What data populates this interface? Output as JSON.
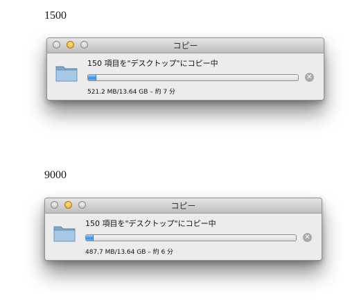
{
  "headings": [
    "1500",
    "9000"
  ],
  "windows": [
    {
      "title": "コピー",
      "message": "150 項目を\"デスクトップ\"にコピー中",
      "status": "521.2 MB/13.64 GB – 約 7 分",
      "progress_fraction": 0.038
    },
    {
      "title": "コピー",
      "message": "150 項目を\"デスクトップ\"にコピー中",
      "status": "487.7 MB/13.64 GB – 約 6 分",
      "progress_fraction": 0.036
    }
  ],
  "icons": {
    "folder": "folder-icon",
    "cancel": "cancel-icon",
    "close": "close-light",
    "minimize": "minimize-light",
    "zoom": "zoom-light"
  }
}
